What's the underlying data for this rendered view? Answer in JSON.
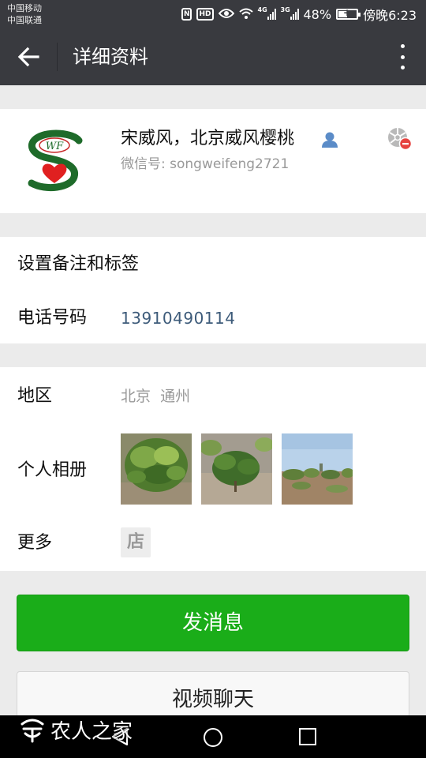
{
  "status_bar": {
    "carrier_1": "中国移动",
    "carrier_2": "中国联通",
    "network_1": "4G",
    "network_2": "3G",
    "battery": "48%",
    "battery_level": 0.48,
    "time": "傍晚6:23",
    "hd_label": "HD",
    "nfc_label": "N"
  },
  "header": {
    "title": "详细资料",
    "back_icon": "arrow-left-icon",
    "more_icon": "more-vertical-icon"
  },
  "profile": {
    "nickname": "宋威风，北京威风樱桃",
    "wechat_id": "微信号: songweifeng2721",
    "avatar_text": "WF"
  },
  "info_section": {
    "remark_label": "设置备注和标签",
    "phone_label": "电话号码",
    "phone_value": "13910490114"
  },
  "detail_section": {
    "region_label": "地区",
    "region_value": "北京  通州",
    "album_label": "个人相册",
    "more_label": "更多",
    "store_glyph": "店"
  },
  "actions": {
    "send_message": "发消息",
    "video_chat": "视频聊天"
  },
  "watermark": {
    "text": "农人之家"
  },
  "colors": {
    "header_bg": "#393a3f",
    "primary_green": "#1aad19",
    "link_blue": "#3d5b7a",
    "page_bg": "#ebebeb"
  }
}
